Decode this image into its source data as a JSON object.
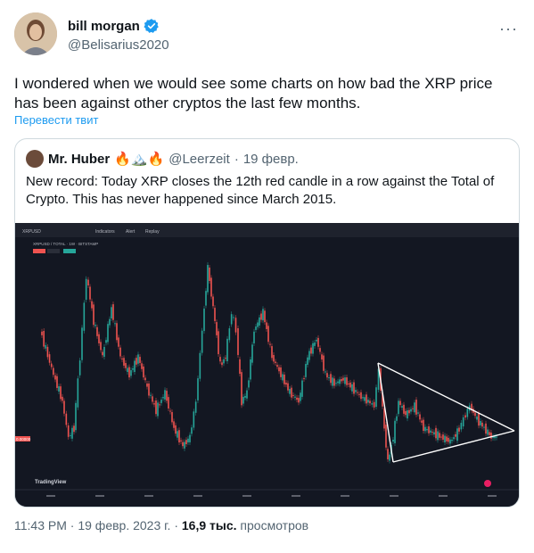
{
  "author": {
    "name": "bill morgan",
    "handle": "@Belisarius2020",
    "verified_color": "#1d9bf0"
  },
  "more_icon": "more-horizontal-icon",
  "tweet": {
    "text": "I wondered when we would see some charts on how bad the XRP price has been against other cryptos the last few months.",
    "translate_label": "Перевести твит"
  },
  "quoted": {
    "name": "Mr. Huber",
    "emojis": "🔥🏔️🔥",
    "handle": "@Leerzeit",
    "separator": "·",
    "date": "19 февр.",
    "text": "New record: Today XRP closes the 12th red candle in a row against the Total of Crypto. This has never happened since March 2015."
  },
  "chart": {
    "symbol_label": "XRPUSD / TOTAL · 1W · BITSTAMP",
    "toolbar_items": [
      "XRPUSD",
      "Indicators",
      "Alert",
      "Replay"
    ],
    "price_badge": "0.00000",
    "watermark": "TradingView",
    "up_color": "#26a69a",
    "down_color": "#ef5350",
    "background": "#131722"
  },
  "footer": {
    "time": "11:43 PM",
    "separator1": "·",
    "date": "19 февр. 2023 г.",
    "separator2": "·",
    "views_count": "16,9 тыс.",
    "views_label": "просмотров"
  }
}
